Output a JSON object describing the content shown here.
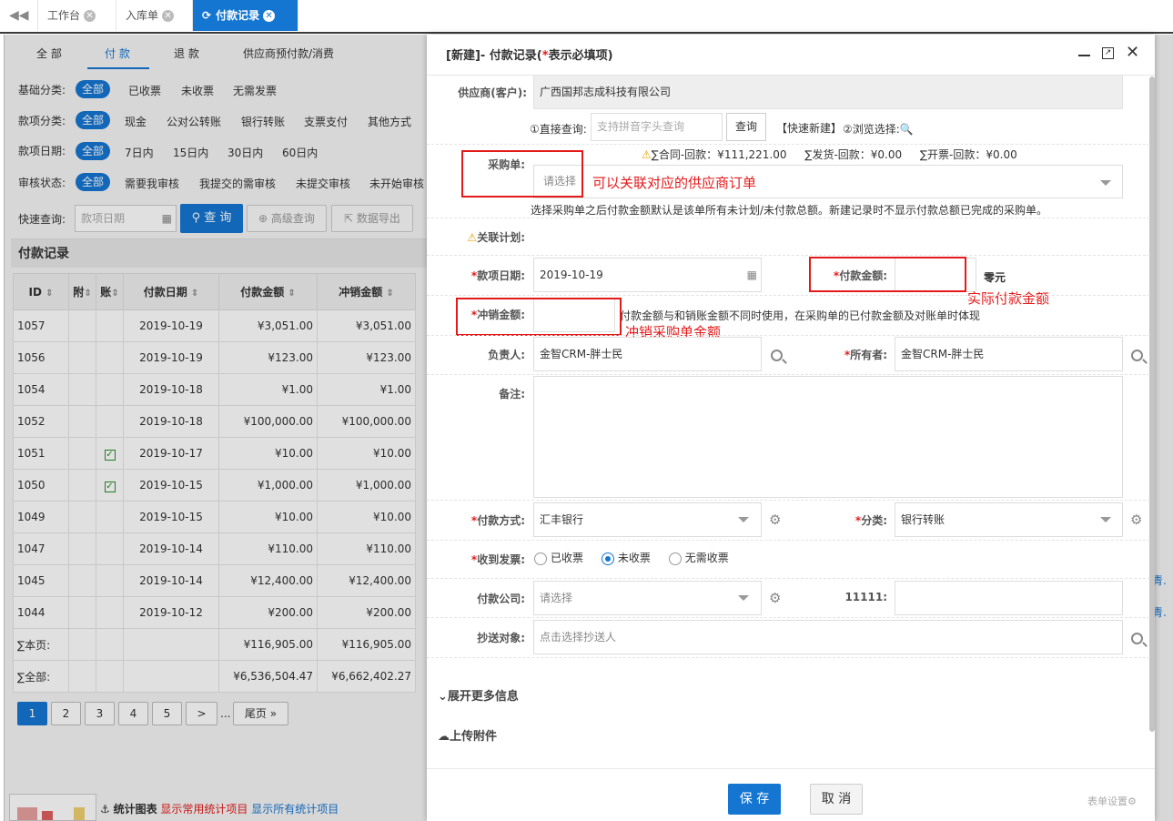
{
  "tabs": {
    "back_icon": "double-left-arrow-icon",
    "items": [
      {
        "label": "工作台"
      },
      {
        "label": "入库单"
      },
      {
        "label": "付款记录",
        "active": true
      }
    ]
  },
  "subtabs": [
    "全 部",
    "付 款",
    "退 款",
    "供应商预付款/消费"
  ],
  "filters": {
    "basic": {
      "label": "基础分类:",
      "all": "全部",
      "options": [
        "已收票",
        "未收票",
        "无需发票"
      ]
    },
    "item_type": {
      "label": "款项分类:",
      "all": "全部",
      "options": [
        "现金",
        "公对公转账",
        "银行转账",
        "支票支付",
        "其他方式"
      ]
    },
    "item_date": {
      "label": "款项日期:",
      "all": "全部",
      "options": [
        "7日内",
        "15日内",
        "30日内",
        "60日内"
      ]
    },
    "audit": {
      "label": "审核状态:",
      "all": "全部",
      "options": [
        "需要我审核",
        "我提交的需审核",
        "未提交审核",
        "未开始审核"
      ]
    }
  },
  "quick_search": {
    "label": "快速查询:",
    "placeholder": "款项日期",
    "search_btn": "查 询",
    "advanced_btn": "高级查询",
    "export_btn": "数据导出"
  },
  "table": {
    "title": "付款记录",
    "headers": [
      "ID",
      "附",
      "账",
      "付款日期",
      "付款金额",
      "冲销金额"
    ],
    "rows": [
      {
        "id": "1057",
        "checked": false,
        "date": "2019-10-19",
        "amount": "¥3,051.00",
        "offset": "¥3,051.00"
      },
      {
        "id": "1056",
        "checked": false,
        "date": "2019-10-19",
        "amount": "¥123.00",
        "offset": "¥123.00"
      },
      {
        "id": "1054",
        "checked": false,
        "date": "2019-10-18",
        "amount": "¥1.00",
        "offset": "¥1.00"
      },
      {
        "id": "1052",
        "checked": false,
        "date": "2019-10-18",
        "amount": "¥100,000.00",
        "offset": "¥100,000.00"
      },
      {
        "id": "1051",
        "checked": true,
        "date": "2019-10-17",
        "amount": "¥10.00",
        "offset": "¥10.00"
      },
      {
        "id": "1050",
        "checked": true,
        "date": "2019-10-15",
        "amount": "¥1,000.00",
        "offset": "¥1,000.00"
      },
      {
        "id": "1049",
        "checked": false,
        "date": "2019-10-15",
        "amount": "¥10.00",
        "offset": "¥10.00"
      },
      {
        "id": "1047",
        "checked": false,
        "date": "2019-10-14",
        "amount": "¥110.00",
        "offset": "¥110.00"
      },
      {
        "id": "1045",
        "checked": false,
        "date": "2019-10-14",
        "amount": "¥12,400.00",
        "offset": "¥12,400.00"
      },
      {
        "id": "1044",
        "checked": false,
        "date": "2019-10-12",
        "amount": "¥200.00",
        "offset": "¥200.00"
      }
    ],
    "page_total": {
      "label": "∑本页:",
      "amount": "¥116,905.00",
      "offset": "¥116,905.00"
    },
    "all_total": {
      "label": "∑全部:",
      "amount": "¥6,536,504.47",
      "offset": "¥6,662,402.27"
    },
    "right_clip": [
      "青.",
      "青."
    ]
  },
  "pagination": {
    "pages": [
      "1",
      "2",
      "3",
      "4",
      "5"
    ],
    "next": ">",
    "ellipsis": "...",
    "last": "尾页 »"
  },
  "footer": {
    "stats_label": "统计图表",
    "show_common": "显示常用统计项目",
    "show_all": "显示所有统计项目"
  },
  "modal": {
    "title_prefix": "[新建]- 付款记录(",
    "title_star": "*",
    "title_suffix": "表示必填项)",
    "supplier": {
      "label": "供应商(客户):",
      "value": "广西国邦志成科技有限公司"
    },
    "direct_query": {
      "label": "①直接查询:",
      "placeholder": "支持拼音字头查询",
      "btn": "查询",
      "quick_new": "【快速新建】",
      "browse": "②浏览选择:"
    },
    "summary": {
      "contract": "∑合同-回款：¥111,221.00",
      "shipped": "∑发货-回款：¥0.00",
      "invoiced": "∑开票-回款：¥0.00"
    },
    "purchase": {
      "label": "采购单:",
      "placeholder": "请选择",
      "annotation": "可以关联对应的供应商订单",
      "hint": "选择采购单之后付款金额默认是该单所有未计划/未付款总额。新建记录时不显示付款总额已完成的采购单。"
    },
    "plan": {
      "label": "关联计划:"
    },
    "date": {
      "label": "款项日期:",
      "value": "2019-10-19"
    },
    "amount": {
      "label": "付款金额:",
      "value": "",
      "unit": "零元",
      "annotation": "实际付款金额"
    },
    "offset": {
      "label": "冲销金额:",
      "value": "",
      "hint": "付款金额与和销账金额不同时使用，在采购单的已付款金额及对账单时体现",
      "annotation": "冲销采购单金额"
    },
    "owner": {
      "label": "负责人:",
      "value": "金智CRM-胖士民"
    },
    "holder": {
      "label": "所有者:",
      "value": "金智CRM-胖士民"
    },
    "remark": {
      "label": "备注:",
      "value": ""
    },
    "pay_method": {
      "label": "付款方式:",
      "value": "汇丰银行"
    },
    "category": {
      "label": "分类:",
      "value": "银行转账"
    },
    "invoice": {
      "label": "收到发票:",
      "options": [
        "已收票",
        "未收票",
        "无需收票"
      ],
      "selected": 1
    },
    "company": {
      "label": "付款公司:",
      "placeholder": "请选择"
    },
    "custom": {
      "label": "11111:",
      "value": ""
    },
    "cc": {
      "label": "抄送对象:",
      "placeholder": "点击选择抄送人"
    },
    "expand": "展开更多信息",
    "upload": "上传附件",
    "save": "保 存",
    "cancel": "取 消",
    "form_settings": "表单设置"
  },
  "colors": {
    "accent": "#1576d2",
    "required": "#e41a1a",
    "annotation": "#e41a1a"
  }
}
